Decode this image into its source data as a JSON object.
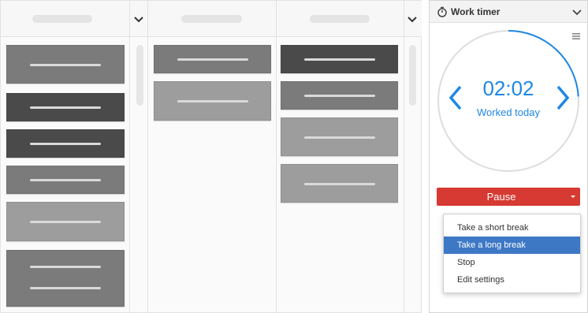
{
  "timer_widget": {
    "title": "Work timer",
    "time": "02:02",
    "subtitle": "Worked today",
    "pause_label": "Pause",
    "accent_color": "#1e88e5",
    "pause_color": "#d63a32",
    "progress_fraction": 0.24,
    "menu": [
      {
        "label": "Take a short break",
        "active": false
      },
      {
        "label": "Take a long break",
        "active": true
      },
      {
        "label": "Stop",
        "active": false
      },
      {
        "label": "Edit settings",
        "active": false
      }
    ],
    "icons": {
      "title": "stopwatch-icon",
      "collapse": "chevron-down-icon",
      "menu": "hamburger-menu-icon",
      "prev": "chevron-left-icon",
      "next": "chevron-right-icon",
      "caret": "caret-down-icon"
    }
  },
  "board": {
    "columns": [
      {
        "header": "",
        "cards": 6
      },
      {
        "header": "",
        "cards": 2
      },
      {
        "header": "",
        "cards": 4
      }
    ]
  }
}
